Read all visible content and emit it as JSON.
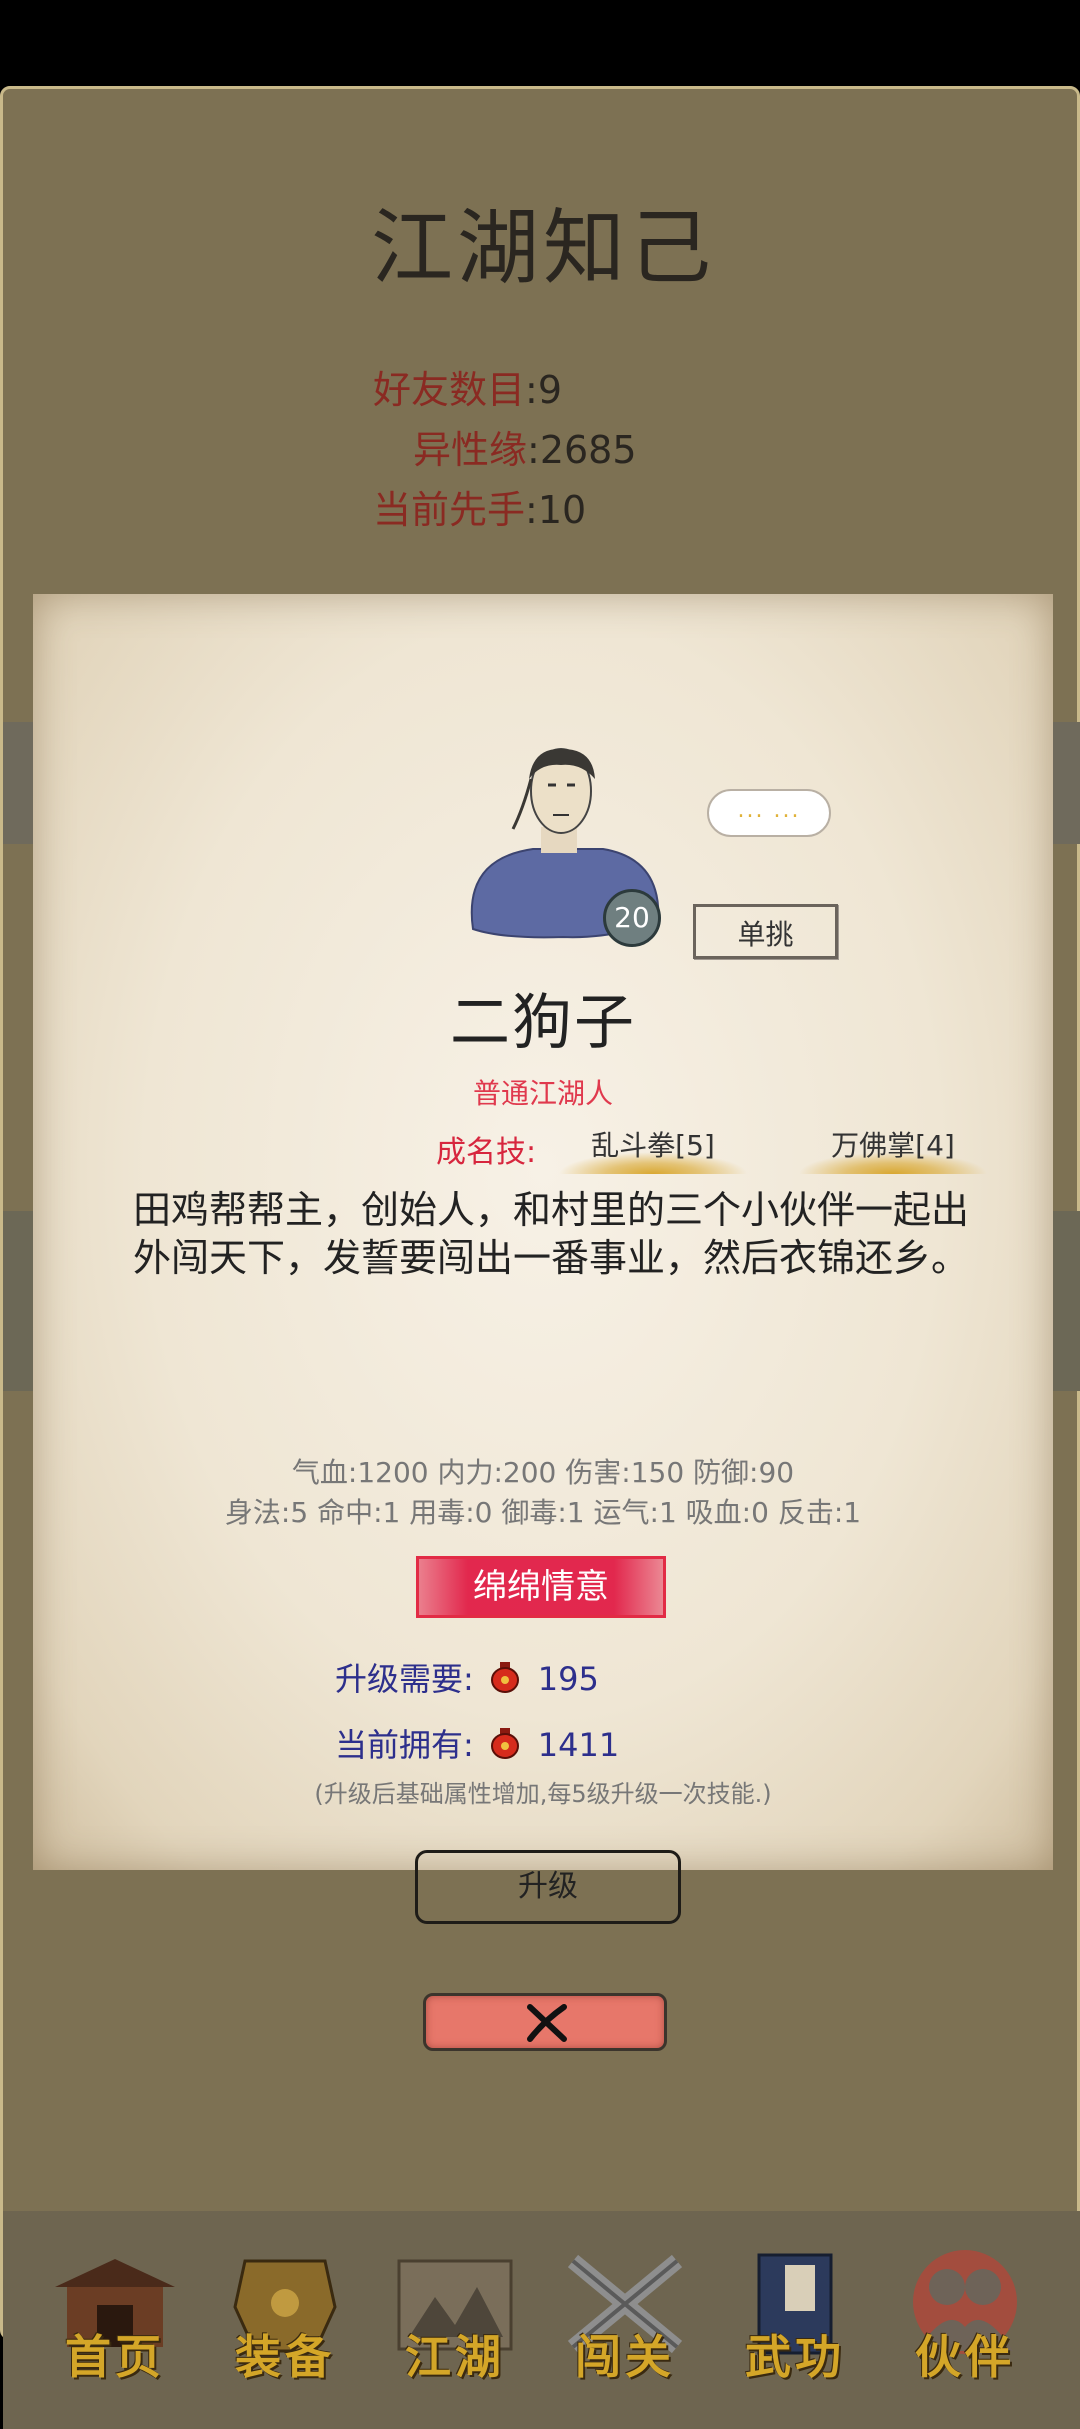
{
  "header": {
    "title": "江湖知己"
  },
  "stats": [
    {
      "label": "好友数目",
      "value": "9"
    },
    {
      "label": "异性缘",
      "value": "2685"
    },
    {
      "label": "当前先手",
      "value": "10"
    }
  ],
  "partner": {
    "level": "20",
    "speech": "... ...",
    "duel_label": "单挑",
    "name": "二狗子",
    "rank": "普通江湖人",
    "skills_label": "成名技:",
    "skills": [
      "乱斗拳[5]",
      "万佛掌[4]"
    ],
    "description": "田鸡帮帮主，创始人，和村里的三个小伙伴一起出外闯天下，发誓要闯出一番事业，然后衣锦还乡。",
    "attrs_line1": "气血:1200  内力:200  伤害:150  防御:90",
    "attrs_line2": "身法:5  命中:1  用毒:0  御毒:1  运气:1  吸血:0  反击:1",
    "special": "绵绵情意",
    "upgrade_need_label": "升级需要:",
    "upgrade_need_value": "195",
    "owned_label": "当前拥有:",
    "owned_value": "1411",
    "note": "(升级后基础属性增加,每5级升级一次技能.)",
    "upgrade_label": "升级"
  },
  "icons": {
    "currency": "red-jar-icon",
    "close": "close-x-icon"
  },
  "nav": [
    {
      "label": "首页",
      "icon": "home-pavilion-icon"
    },
    {
      "label": "装备",
      "icon": "armor-icon"
    },
    {
      "label": "江湖",
      "icon": "scroll-map-icon"
    },
    {
      "label": "闯关",
      "icon": "crossed-swords-icon"
    },
    {
      "label": "武功",
      "icon": "manual-book-icon"
    },
    {
      "label": "伙伴",
      "icon": "partners-icon"
    }
  ],
  "colors": {
    "accent_red": "#e22b45",
    "gold": "#d4a628",
    "panel": "#7d7153"
  }
}
